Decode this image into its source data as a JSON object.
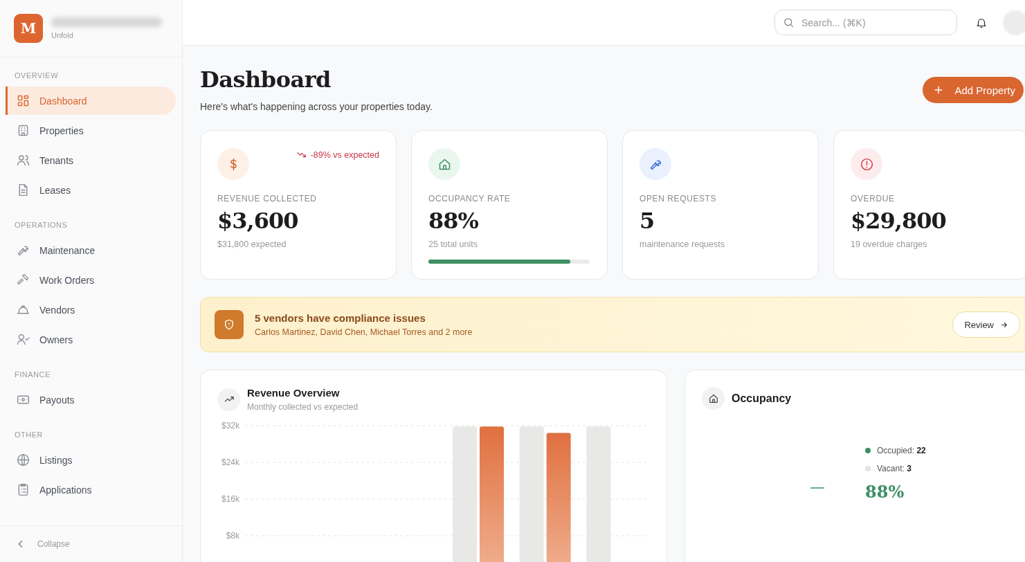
{
  "brand": {
    "logo_letter": "M",
    "subtitle": "Unfold"
  },
  "sidebar": {
    "sections": [
      {
        "heading": "OVERVIEW",
        "items": [
          {
            "label": "Dashboard",
            "selected": true
          },
          {
            "label": "Properties",
            "selected": false
          },
          {
            "label": "Tenants",
            "selected": false
          },
          {
            "label": "Leases",
            "selected": false
          }
        ]
      },
      {
        "heading": "OPERATIONS",
        "items": [
          {
            "label": "Maintenance",
            "selected": false
          },
          {
            "label": "Work Orders",
            "selected": false
          },
          {
            "label": "Vendors",
            "selected": false
          },
          {
            "label": "Owners",
            "selected": false
          }
        ]
      },
      {
        "heading": "FINANCE",
        "items": [
          {
            "label": "Payouts",
            "selected": false
          }
        ]
      },
      {
        "heading": "OTHER",
        "items": [
          {
            "label": "Listings",
            "selected": false
          },
          {
            "label": "Applications",
            "selected": false
          }
        ]
      }
    ],
    "collapse": "Collapse"
  },
  "header": {
    "search": {
      "placeholder": "Search... (⌘K)"
    }
  },
  "page": {
    "title": "Dashboard",
    "subtitle": "Here's what's happening across your properties today.",
    "action": "Add Property"
  },
  "stats": [
    {
      "kind": "revenue",
      "label": "REVENUE COLLECTED",
      "value": "$3,600",
      "note": "$31,800 expected",
      "trend": "-89% vs expected"
    },
    {
      "kind": "occupancy",
      "label": "OCCUPANCY RATE",
      "value": "88%",
      "note": "25 total units",
      "level": 0.88
    },
    {
      "kind": "requests",
      "label": "OPEN REQUESTS",
      "value": "5",
      "note": "maintenance requests"
    },
    {
      "kind": "overdue",
      "label": "OVERDUE",
      "value": "$29,800",
      "note": "19 overdue charges"
    }
  ],
  "alert": {
    "title": "5 vendors have compliance issues",
    "text": "Carlos Martinez, David Chen, Michael Torres and 2 more",
    "button": "Review"
  },
  "revenue": {
    "title": "Revenue Overview",
    "subtitle": "Monthly collected vs expected",
    "chart_data": {
      "type": "bar",
      "grid": true,
      "ylim": [
        0,
        32000
      ],
      "yticks": [
        {
          "value": 8000,
          "label": "$8k"
        },
        {
          "value": 16000,
          "label": "$16k"
        },
        {
          "value": 24000,
          "label": "$24k"
        },
        {
          "value": 32000,
          "label": "$32k"
        }
      ],
      "series": [
        {
          "color": "#e8e8e6",
          "values": [
            0,
            0,
            0,
            31800,
            31800,
            31800
          ]
        },
        {
          "color": "#e07040",
          "values": [
            0,
            0,
            0,
            31800,
            30400,
            0
          ]
        }
      ]
    }
  },
  "occupancy": {
    "title": "Occupancy",
    "legend": [
      {
        "label": "Occupied:",
        "value": "22",
        "color": "#3d8f63"
      },
      {
        "label": "Vacant:",
        "value": "3",
        "color": "#e4e4e4"
      }
    ],
    "percent": "88%"
  }
}
